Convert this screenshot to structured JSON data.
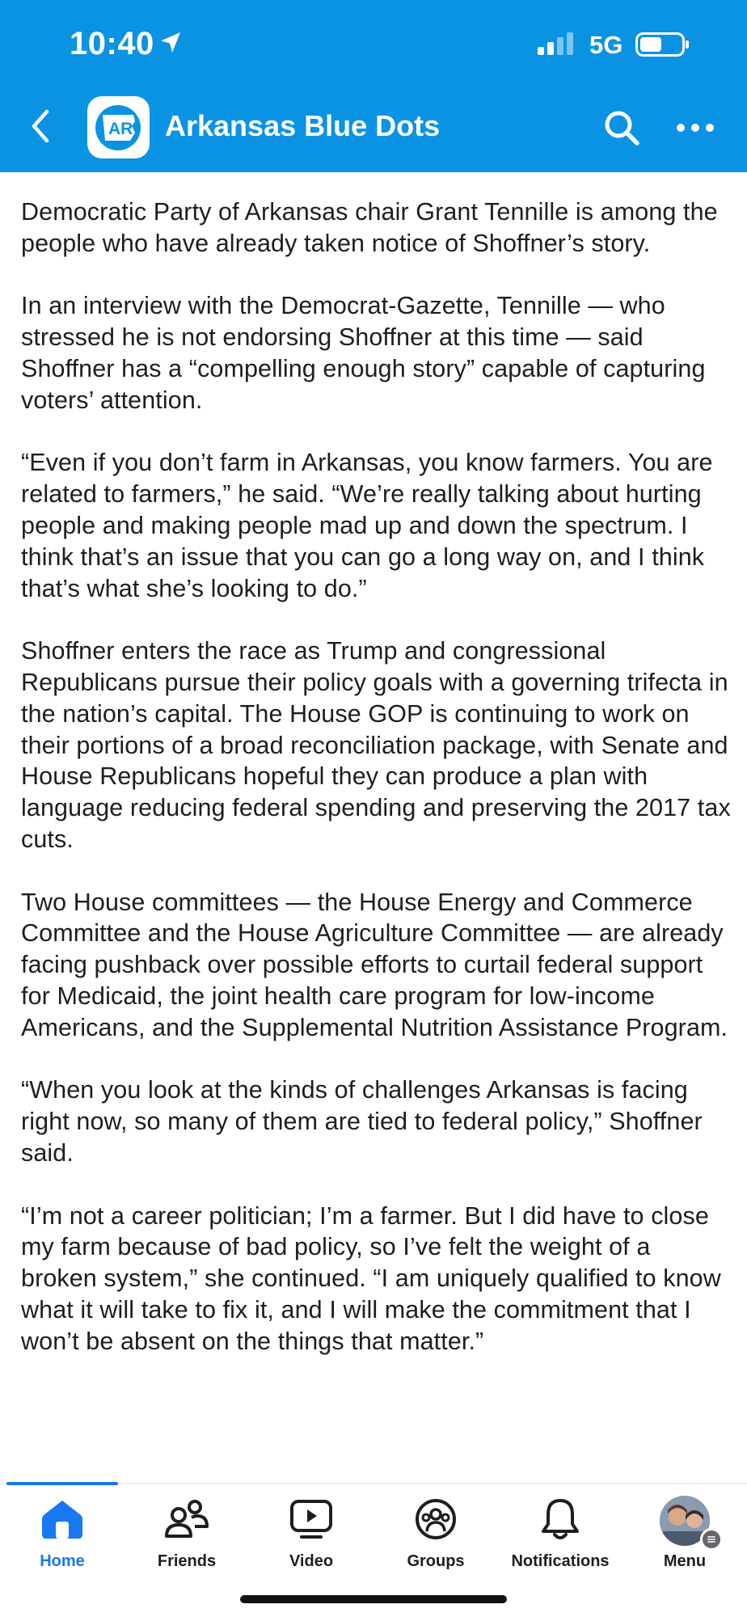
{
  "status_bar": {
    "time": "10:40",
    "network": "5G",
    "icons": [
      "location-arrow-icon",
      "signal-icon",
      "battery-icon"
    ]
  },
  "header": {
    "title": "Arkansas Blue Dots",
    "avatar_text": "AR",
    "icons": [
      "back-chevron-icon",
      "search-icon",
      "more-dots-icon"
    ]
  },
  "article": {
    "paragraphs": [
      "Democratic Party of Arkansas chair Grant Tennille is among the people who have already taken notice of Shoffner’s story.",
      "In an interview with the Democrat-Gazette, Tennille — who stressed he is not endorsing Shoffner at this time — said Shoffner has a “compelling enough story” capable of capturing voters’ attention.",
      "“Even if you don’t farm in Arkansas, you know farmers. You are related to farmers,” he said. “We’re really talking about hurting people and making people mad up and down the spectrum. I think that’s an issue that you can go a long way on, and I think that’s what she’s looking to do.”",
      "Shoffner enters the race as Trump and congressional Republicans pursue their policy goals with a governing trifecta in the nation’s capital. The House GOP is continuing to work on their portions of a broad reconciliation package, with Senate and House Republicans hopeful they can produce a plan with language reducing federal spending and preserving the 2017 tax cuts.",
      "Two House committees — the House Energy and Commerce Committee and the House Agriculture Committee — are already facing pushback over possible efforts to curtail federal support for Medicaid, the joint health care program for low-income Americans, and the Supplemental Nutrition Assistance Program.",
      "“When you look at the kinds of challenges Arkansas is facing right now, so many of them are tied to federal policy,” Shoffner said.",
      "“I’m not a career politician; I’m a farmer. But I did have to close my farm because of bad policy, so I’ve felt the weight of a broken system,” she continued. “I am uniquely qualified to know what it will take to fix it, and I will make the commitment that I won’t be absent on the things that matter.”"
    ]
  },
  "tabs": [
    {
      "label": "Home",
      "icon": "home-icon",
      "active": true
    },
    {
      "label": "Friends",
      "icon": "friends-icon",
      "active": false
    },
    {
      "label": "Video",
      "icon": "video-icon",
      "active": false
    },
    {
      "label": "Groups",
      "icon": "groups-icon",
      "active": false
    },
    {
      "label": "Notifications",
      "icon": "bell-icon",
      "active": false
    },
    {
      "label": "Menu",
      "icon": "profile-avatar",
      "active": false
    }
  ],
  "colors": {
    "header_bg": "#0a93e2",
    "accent": "#1877f2",
    "text": "#1c1e21"
  }
}
